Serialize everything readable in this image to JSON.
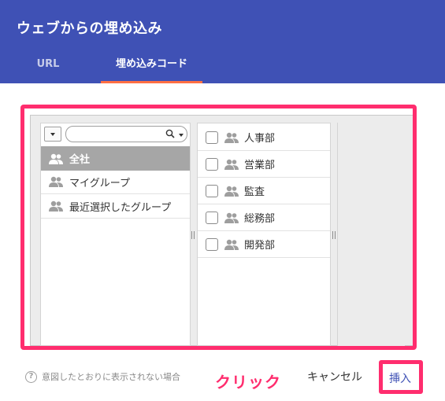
{
  "dialog": {
    "title": "ウェブからの埋め込み",
    "tabs": [
      {
        "label": "URL",
        "active": false
      },
      {
        "label": "埋め込みコード",
        "active": true
      }
    ]
  },
  "picker": {
    "search": {
      "placeholder": ""
    },
    "groups": [
      {
        "label": "全社",
        "selected": true
      },
      {
        "label": "マイグループ",
        "selected": false
      },
      {
        "label": "最近選択したグループ",
        "selected": false
      }
    ],
    "members": [
      {
        "label": "人事部",
        "checked": false
      },
      {
        "label": "営業部",
        "checked": false
      },
      {
        "label": "監査",
        "checked": false
      },
      {
        "label": "総務部",
        "checked": false
      },
      {
        "label": "開発部",
        "checked": false
      }
    ]
  },
  "footer": {
    "help_text": "意図したとおりに表示されない場合",
    "annotation": "クリック",
    "cancel_label": "キャンセル",
    "insert_label": "挿入"
  },
  "colors": {
    "header": "#3f51b5",
    "tab_indicator": "#ff7043",
    "highlight": "#ff2d6e",
    "selected_row": "#a6a6a6"
  }
}
